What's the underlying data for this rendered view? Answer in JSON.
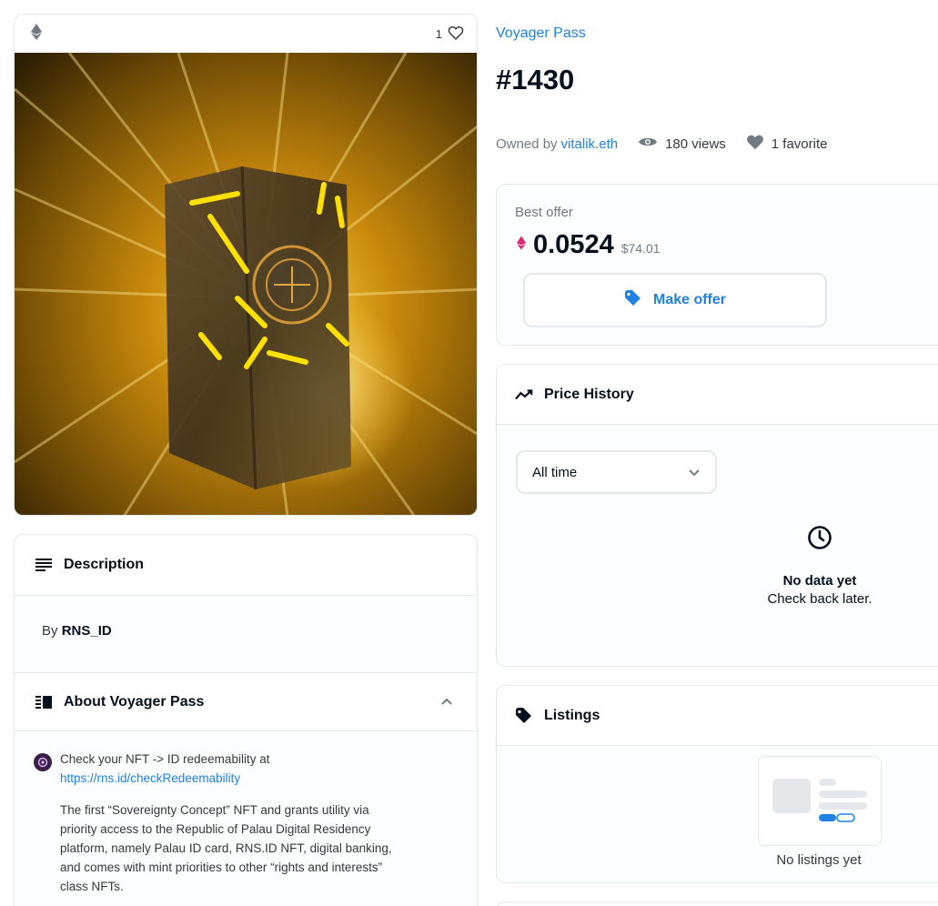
{
  "image_card": {
    "favorite_count": "1",
    "icons": {
      "chain": "ethereum-icon",
      "favorite": "heart-outline-icon"
    }
  },
  "description": {
    "heading": "Description",
    "by_prefix": "By",
    "creator": "RNS_ID"
  },
  "about": {
    "heading": "About Voyager Pass",
    "line1": "Check your NFT -> ID redeemability at",
    "link": "https://rns.id/checkRedeemability",
    "paragraph_lines": [
      "The first “Sovereignty Concept” NFT and grants utility via",
      "priority access to the Republic of Palau Digital Residency",
      "platform, namely Palau ID card, RNS.ID NFT, digital banking,",
      "and comes with mint priorities to other “rights and interests”",
      "class NFTs."
    ]
  },
  "header": {
    "collection": "Voyager Pass",
    "token_title": "#1430",
    "owned_by_label": "Owned by",
    "owner": "vitalik.eth",
    "views": "180 views",
    "favorites": "1 favorite"
  },
  "offer": {
    "label": "Best offer",
    "price": "0.0524",
    "usd": "$74.01",
    "button_label": "Make offer"
  },
  "price_history": {
    "heading": "Price History",
    "select_value": "All time",
    "empty_title": "No data yet",
    "empty_subtitle": "Check back later."
  },
  "listings": {
    "heading": "Listings",
    "empty_text": "No listings yet"
  },
  "colors": {
    "accent": "#2081e2",
    "text": "#04111d",
    "muted": "#707a83",
    "border": "#e5e8eb",
    "eth": "#e42575"
  }
}
